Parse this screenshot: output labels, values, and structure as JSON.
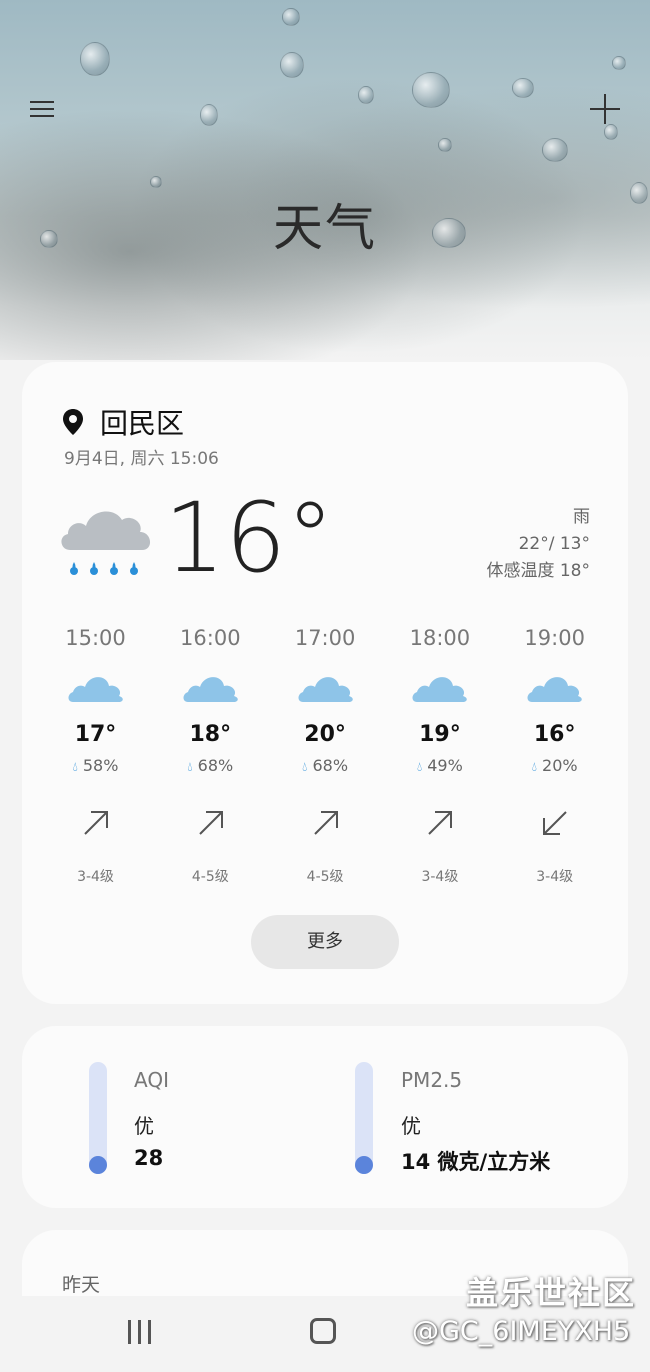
{
  "header": {
    "title": "天气",
    "menu_icon": "menu-icon",
    "add_icon": "add-icon"
  },
  "current": {
    "location": "回民区",
    "datetime": "9月4日, 周六 15:06",
    "temperature": "16°",
    "condition": "雨",
    "high_low": "22°/ 13°",
    "feels_like": "体感温度 18°",
    "icon": "rain-cloud-icon"
  },
  "hourly": [
    {
      "time": "15:00",
      "temp": "17°",
      "humidity": "58%",
      "wind": "3-4级",
      "wind_dir": "up-right"
    },
    {
      "time": "16:00",
      "temp": "18°",
      "humidity": "68%",
      "wind": "4-5级",
      "wind_dir": "up-right"
    },
    {
      "time": "17:00",
      "temp": "20°",
      "humidity": "68%",
      "wind": "4-5级",
      "wind_dir": "up-right"
    },
    {
      "time": "18:00",
      "temp": "19°",
      "humidity": "49%",
      "wind": "3-4级",
      "wind_dir": "up-right"
    },
    {
      "time": "19:00",
      "temp": "16°",
      "humidity": "20%",
      "wind": "3-4级",
      "wind_dir": "down-left"
    }
  ],
  "more_button": "更多",
  "air": {
    "aqi": {
      "label": "AQI",
      "level": "优",
      "value": "28"
    },
    "pm25": {
      "label": "PM2.5",
      "level": "优",
      "value": "14 微克/立方米"
    }
  },
  "yesterday": {
    "label": "昨天"
  },
  "watermark": {
    "line1": "盖乐世社区",
    "line2": "@GC_6IMEYXH5"
  },
  "colors": {
    "accent": "#5b84db",
    "gauge_track": "#dbe3f7",
    "cloud": "#8ec4e8",
    "raindrop": "#2a8fd8"
  }
}
